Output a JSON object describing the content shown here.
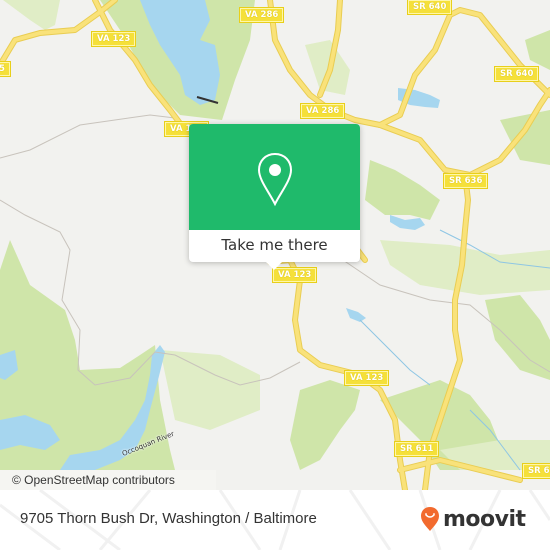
{
  "map": {
    "road_labels": [
      {
        "id": "va123-nw",
        "text": "VA 123"
      },
      {
        "id": "va123-mid",
        "text": "VA 123"
      },
      {
        "id": "va123-pin",
        "text": "VA 123"
      },
      {
        "id": "va123-south",
        "text": "VA 123"
      },
      {
        "id": "va286-top",
        "text": "VA 286"
      },
      {
        "id": "va286-mid",
        "text": "VA 286"
      },
      {
        "id": "sr640-top",
        "text": "SR 640"
      },
      {
        "id": "sr640-right",
        "text": "SR 640"
      },
      {
        "id": "sr636",
        "text": "SR 636"
      },
      {
        "id": "sr611",
        "text": "SR 611"
      },
      {
        "id": "sr6-edge",
        "text": "SR 6"
      },
      {
        "id": "left-edge",
        "text": "5"
      }
    ],
    "water_labels": [
      {
        "id": "occoquan",
        "text": "Occoquan River"
      }
    ],
    "attribution": "© OpenStreetMap contributors",
    "colors": {
      "land": "#f2f2ef",
      "park": "#cfe5a9",
      "park_light": "#e0edc6",
      "water": "#a6d6ef",
      "road": "#f9e27a",
      "road_outline": "#e9cd52",
      "shield": "#f5e03a"
    }
  },
  "popup": {
    "icon": "map-pin-icon",
    "button_label": "Take me there",
    "color": "#1fba6b"
  },
  "footer": {
    "address": "9705 Thorn Bush Dr, Washington / Baltimore",
    "brand": "moovit",
    "brand_icon": "moovit-smile-pin-icon",
    "brand_color": "#f26a2e"
  }
}
